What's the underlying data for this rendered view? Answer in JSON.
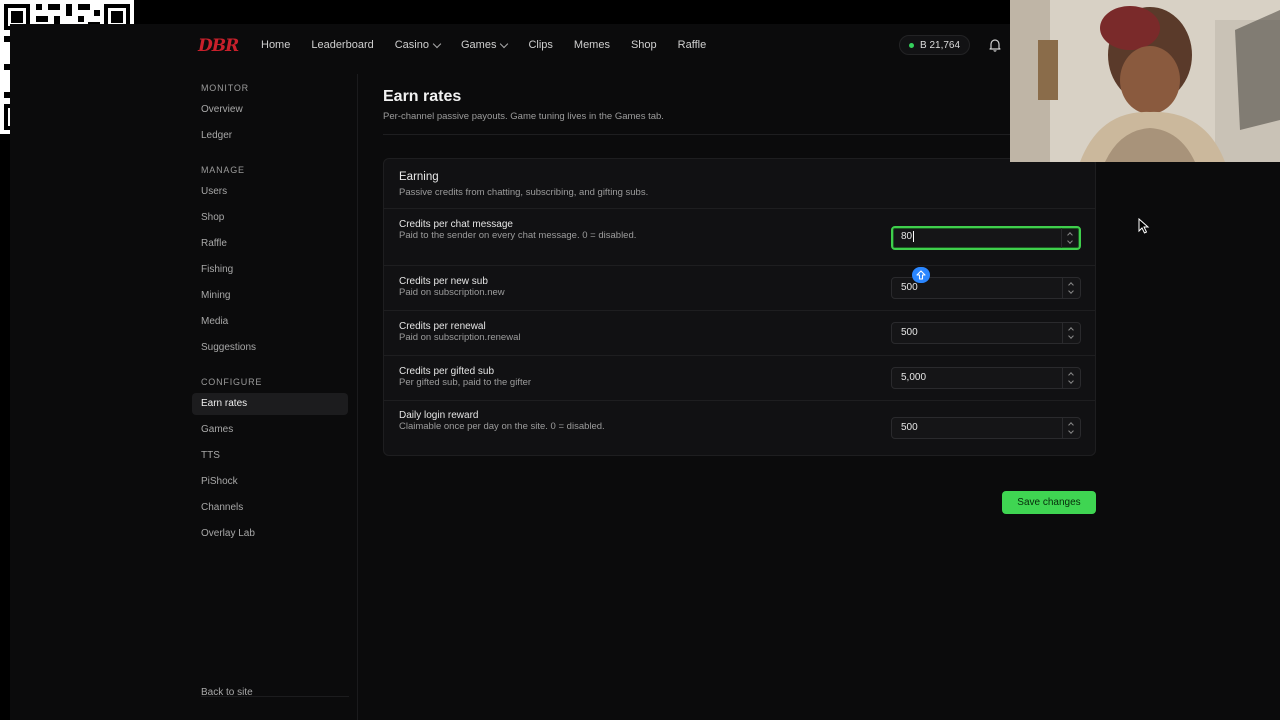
{
  "nav": {
    "logo": "DBR",
    "links": [
      {
        "label": "Home",
        "dropdown": false
      },
      {
        "label": "Leaderboard",
        "dropdown": false
      },
      {
        "label": "Casino",
        "dropdown": true
      },
      {
        "label": "Games",
        "dropdown": true
      },
      {
        "label": "Clips",
        "dropdown": false
      },
      {
        "label": "Memes",
        "dropdown": false
      },
      {
        "label": "Shop",
        "dropdown": false
      },
      {
        "label": "Raffle",
        "dropdown": false
      }
    ],
    "balance": "B 21,764"
  },
  "sidebar": {
    "sections": [
      {
        "title": "MONITOR",
        "items": [
          "Overview",
          "Ledger"
        ]
      },
      {
        "title": "MANAGE",
        "items": [
          "Users",
          "Shop",
          "Raffle",
          "Fishing",
          "Mining",
          "Media",
          "Suggestions"
        ]
      },
      {
        "title": "CONFIGURE",
        "items": [
          "Earn rates",
          "Games",
          "TTS",
          "PiShock",
          "Channels",
          "Overlay Lab"
        ]
      }
    ],
    "active_item": "Earn rates",
    "back_link": "Back to site"
  },
  "page": {
    "title": "Earn rates",
    "subtitle": "Per-channel passive payouts. Game tuning lives in the Games tab."
  },
  "card": {
    "title": "Earning",
    "subtitle": "Passive credits from chatting, subscribing, and gifting subs.",
    "rows": [
      {
        "label": "Credits per chat message",
        "desc": "Paid to the sender on every chat message. 0 = disabled.",
        "value": "80",
        "focused": true
      },
      {
        "label": "Credits per new sub",
        "desc": "Paid on subscription.new",
        "value": "500",
        "focused": false
      },
      {
        "label": "Credits per renewal",
        "desc": "Paid on subscription.renewal",
        "value": "500",
        "focused": false
      },
      {
        "label": "Credits per gifted sub",
        "desc": "Per gifted sub, paid to the gifter",
        "value": "5,000",
        "focused": false
      },
      {
        "label": "Daily login reward",
        "desc": "Claimable once per day on the site. 0 = disabled.",
        "value": "500",
        "focused": false
      }
    ]
  },
  "actions": {
    "save": "Save changes"
  },
  "colors": {
    "accent_green": "#3fd552",
    "focus_ring": "#3fcf4c",
    "logo_red": "#c8202b",
    "badge_blue": "#2a86ff"
  },
  "icons": {
    "bell": "bell-icon",
    "keyboard_badge": "shift-key-icon",
    "cursor": "mouse-pointer-icon"
  }
}
